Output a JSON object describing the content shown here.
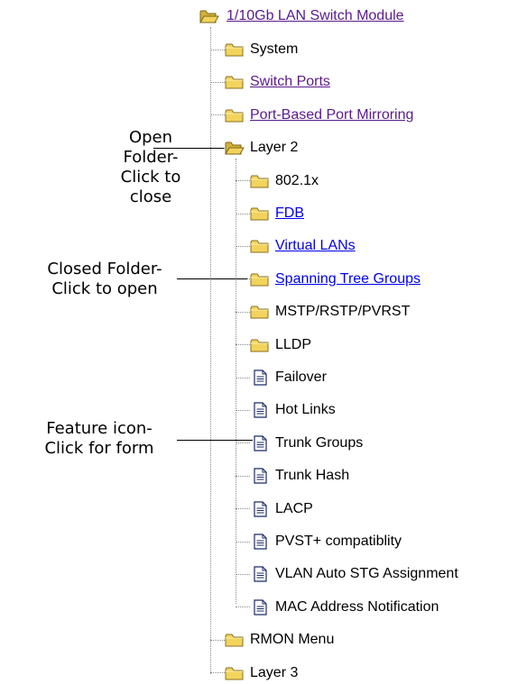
{
  "tree": {
    "root": {
      "label": "1/10Gb LAN Switch Module",
      "icon": "open-folder-icon",
      "link": "purple"
    },
    "items": [
      {
        "label": "System",
        "icon": "folder-icon",
        "level": 1,
        "link": "none"
      },
      {
        "label": "Switch Ports",
        "icon": "folder-icon",
        "level": 1,
        "link": "purple"
      },
      {
        "label": "Port-Based Port Mirroring",
        "icon": "folder-icon",
        "level": 1,
        "link": "purple"
      },
      {
        "label": "Layer 2",
        "icon": "open-folder-icon",
        "level": 1,
        "link": "none"
      },
      {
        "label": "802.1x",
        "icon": "folder-icon",
        "level": 2,
        "link": "none"
      },
      {
        "label": "FDB",
        "icon": "folder-icon",
        "level": 2,
        "link": "blue"
      },
      {
        "label": "Virtual LANs",
        "icon": "folder-icon",
        "level": 2,
        "link": "blue"
      },
      {
        "label": "Spanning Tree Groups",
        "icon": "folder-icon",
        "level": 2,
        "link": "blue"
      },
      {
        "label": "MSTP/RSTP/PVRST",
        "icon": "folder-icon",
        "level": 2,
        "link": "none"
      },
      {
        "label": "LLDP",
        "icon": "folder-icon",
        "level": 2,
        "link": "none"
      },
      {
        "label": "Failover",
        "icon": "document-icon",
        "level": 2,
        "link": "none"
      },
      {
        "label": "Hot Links",
        "icon": "document-icon",
        "level": 2,
        "link": "none"
      },
      {
        "label": "Trunk Groups",
        "icon": "document-icon",
        "level": 2,
        "link": "none"
      },
      {
        "label": "Trunk Hash",
        "icon": "document-icon",
        "level": 2,
        "link": "none"
      },
      {
        "label": "LACP",
        "icon": "document-icon",
        "level": 2,
        "link": "none"
      },
      {
        "label": "PVST+ compatiblity",
        "icon": "document-icon",
        "level": 2,
        "link": "none"
      },
      {
        "label": "VLAN Auto STG Assignment",
        "icon": "document-icon",
        "level": 2,
        "link": "none"
      },
      {
        "label": "MAC Address Notification",
        "icon": "document-icon",
        "level": 2,
        "link": "none"
      },
      {
        "label": "RMON Menu",
        "icon": "folder-icon",
        "level": 1,
        "link": "none"
      },
      {
        "label": "Layer 3",
        "icon": "folder-icon",
        "level": 1,
        "link": "none"
      }
    ]
  },
  "callouts": [
    {
      "line1": "Open Folder-",
      "line2": "Click to close"
    },
    {
      "line1": "Closed Folder-",
      "line2": "Click to open"
    },
    {
      "line1": "Feature icon-",
      "line2": "Click for form"
    }
  ],
  "colors": {
    "folder": "#f2d35c",
    "link_visited": "#5a1a8c",
    "link": "#0000ee"
  }
}
